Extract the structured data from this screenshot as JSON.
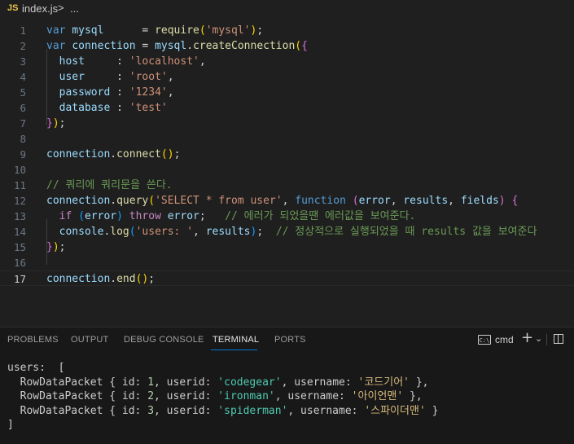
{
  "breadcrumb": {
    "badge": "JS",
    "file": "index.js",
    "separator": ">",
    "more": "..."
  },
  "editor": {
    "active_line": 17,
    "lines": [
      {
        "n": "1",
        "tokens": [
          [
            "kw",
            "var "
          ],
          [
            "var",
            "mysql"
          ],
          [
            "pun",
            "      = "
          ],
          [
            "fn",
            "require"
          ],
          [
            "br1",
            "("
          ],
          [
            "str",
            "'mysql'"
          ],
          [
            "br1",
            ")"
          ],
          [
            "pun",
            ";"
          ]
        ]
      },
      {
        "n": "2",
        "tokens": [
          [
            "kw",
            "var "
          ],
          [
            "var",
            "connection"
          ],
          [
            "pun",
            " = "
          ],
          [
            "var",
            "mysql"
          ],
          [
            "pun",
            "."
          ],
          [
            "fn",
            "createConnection"
          ],
          [
            "br1",
            "("
          ],
          [
            "br2",
            "{"
          ]
        ]
      },
      {
        "n": "3",
        "tokens": [
          [
            "pun",
            "  "
          ],
          [
            "var",
            "host"
          ],
          [
            "pun",
            "     : "
          ],
          [
            "str",
            "'localhost'"
          ],
          [
            "pun",
            ","
          ]
        ]
      },
      {
        "n": "4",
        "tokens": [
          [
            "pun",
            "  "
          ],
          [
            "var",
            "user"
          ],
          [
            "pun",
            "     : "
          ],
          [
            "str",
            "'root'"
          ],
          [
            "pun",
            ","
          ]
        ]
      },
      {
        "n": "5",
        "tokens": [
          [
            "pun",
            "  "
          ],
          [
            "var",
            "password"
          ],
          [
            "pun",
            " : "
          ],
          [
            "str",
            "'1234'"
          ],
          [
            "pun",
            ","
          ]
        ]
      },
      {
        "n": "6",
        "tokens": [
          [
            "pun",
            "  "
          ],
          [
            "var",
            "database"
          ],
          [
            "pun",
            " : "
          ],
          [
            "str",
            "'test'"
          ]
        ]
      },
      {
        "n": "7",
        "tokens": [
          [
            "br2",
            "}"
          ],
          [
            "br1",
            ")"
          ],
          [
            "pun",
            ";"
          ]
        ]
      },
      {
        "n": "8",
        "tokens": []
      },
      {
        "n": "9",
        "tokens": [
          [
            "var",
            "connection"
          ],
          [
            "pun",
            "."
          ],
          [
            "fn",
            "connect"
          ],
          [
            "br1",
            "()"
          ],
          [
            "pun",
            ";"
          ]
        ]
      },
      {
        "n": "10",
        "tokens": []
      },
      {
        "n": "11",
        "tokens": [
          [
            "cmt",
            "// 쿼리에 쿼리문을 쓴다."
          ]
        ]
      },
      {
        "n": "12",
        "tokens": [
          [
            "var",
            "connection"
          ],
          [
            "pun",
            "."
          ],
          [
            "fn",
            "query"
          ],
          [
            "br1",
            "("
          ],
          [
            "str",
            "'SELECT * from user'"
          ],
          [
            "pun",
            ", "
          ],
          [
            "kw",
            "function "
          ],
          [
            "br2",
            "("
          ],
          [
            "var",
            "error"
          ],
          [
            "pun",
            ", "
          ],
          [
            "var",
            "results"
          ],
          [
            "pun",
            ", "
          ],
          [
            "var",
            "fields"
          ],
          [
            "br2",
            ")"
          ],
          [
            "pun",
            " "
          ],
          [
            "br2",
            "{"
          ]
        ]
      },
      {
        "n": "13",
        "tokens": [
          [
            "pun",
            "  "
          ],
          [
            "ctl",
            "if "
          ],
          [
            "br3",
            "("
          ],
          [
            "var",
            "error"
          ],
          [
            "br3",
            ")"
          ],
          [
            "pun",
            " "
          ],
          [
            "ctl",
            "throw "
          ],
          [
            "var",
            "error"
          ],
          [
            "pun",
            ";   "
          ],
          [
            "cmt",
            "// 에러가 되었을땐 에러값을 보여준다."
          ]
        ]
      },
      {
        "n": "14",
        "tokens": [
          [
            "pun",
            "  "
          ],
          [
            "var",
            "console"
          ],
          [
            "pun",
            "."
          ],
          [
            "fn",
            "log"
          ],
          [
            "br3",
            "("
          ],
          [
            "str",
            "'users: '"
          ],
          [
            "pun",
            ", "
          ],
          [
            "var",
            "results"
          ],
          [
            "br3",
            ")"
          ],
          [
            "pun",
            ";  "
          ],
          [
            "cmt",
            "// 정상적으로 실행되었을 때 results 값을 보여준다"
          ]
        ]
      },
      {
        "n": "15",
        "tokens": [
          [
            "br2",
            "}"
          ],
          [
            "br1",
            ")"
          ],
          [
            "pun",
            ";"
          ]
        ]
      },
      {
        "n": "16",
        "tokens": []
      },
      {
        "n": "17",
        "tokens": [
          [
            "var",
            "connection"
          ],
          [
            "pun",
            "."
          ],
          [
            "fn",
            "end"
          ],
          [
            "br1",
            "()"
          ],
          [
            "pun",
            ";"
          ]
        ]
      }
    ]
  },
  "panel": {
    "tabs": [
      "PROBLEMS",
      "OUTPUT",
      "DEBUG CONSOLE",
      "TERMINAL",
      "PORTS"
    ],
    "active_tab": "TERMINAL",
    "terminal_icon_text": "C:\\",
    "terminal_name": "cmd",
    "plus": "+",
    "chevron": "⌄"
  },
  "terminal": {
    "lines": [
      [
        [
          "plain",
          "users:  ["
        ]
      ],
      [
        [
          "plain",
          "  RowDataPacket { id: "
        ],
        [
          "tnum",
          "1"
        ],
        [
          "plain",
          ", userid: "
        ],
        [
          "tstr",
          "'codegear'"
        ],
        [
          "plain",
          ", username: "
        ],
        [
          "tstr2",
          "'코드기어'"
        ],
        [
          "plain",
          " },"
        ]
      ],
      [
        [
          "plain",
          "  RowDataPacket { id: "
        ],
        [
          "tnum",
          "2"
        ],
        [
          "plain",
          ", userid: "
        ],
        [
          "tstr",
          "'ironman'"
        ],
        [
          "plain",
          ", username: "
        ],
        [
          "tstr2",
          "'아이언맨'"
        ],
        [
          "plain",
          " },"
        ]
      ],
      [
        [
          "plain",
          "  RowDataPacket { id: "
        ],
        [
          "tnum",
          "3"
        ],
        [
          "plain",
          ", userid: "
        ],
        [
          "tstr",
          "'spiderman'"
        ],
        [
          "plain",
          ", username: "
        ],
        [
          "tstr2",
          "'스파이더맨'"
        ],
        [
          "plain",
          " }"
        ]
      ],
      [
        [
          "plain",
          "]"
        ]
      ]
    ]
  },
  "colors": {
    "keyword": "#569cd6",
    "variable": "#9cdcfe",
    "function": "#dcdcaa",
    "string": "#ce9178",
    "comment": "#6a9955",
    "control": "#c586c0",
    "accent": "#0078d4",
    "background": "#1f1f1f"
  }
}
